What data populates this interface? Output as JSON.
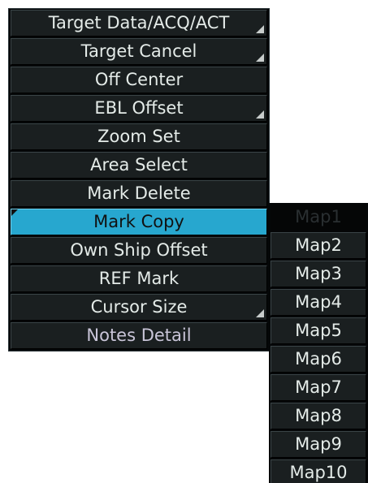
{
  "context_menu": {
    "items": [
      {
        "label": "Target Data/ACQ/ACT",
        "submenu": true
      },
      {
        "label": "Target Cancel",
        "submenu": true
      },
      {
        "label": "Off Center",
        "submenu": false
      },
      {
        "label": "EBL Offset",
        "submenu": true
      },
      {
        "label": "Zoom Set",
        "submenu": false
      },
      {
        "label": "Area Select",
        "submenu": false
      },
      {
        "label": "Mark Delete",
        "submenu": false
      },
      {
        "label": "Mark Copy",
        "submenu": false,
        "selected": true
      },
      {
        "label": "Own Ship Offset",
        "submenu": false
      },
      {
        "label": "REF Mark",
        "submenu": false
      },
      {
        "label": "Cursor Size",
        "submenu": true
      },
      {
        "label": "Notes Detail",
        "submenu": false
      }
    ]
  },
  "map_submenu": {
    "items": [
      {
        "label": "Map1",
        "enabled": false
      },
      {
        "label": "Map2",
        "enabled": true
      },
      {
        "label": "Map3",
        "enabled": true
      },
      {
        "label": "Map4",
        "enabled": true
      },
      {
        "label": "Map5",
        "enabled": true
      },
      {
        "label": "Map6",
        "enabled": true
      },
      {
        "label": "Map7",
        "enabled": true
      },
      {
        "label": "Map8",
        "enabled": true
      },
      {
        "label": "Map9",
        "enabled": true
      },
      {
        "label": "Map10",
        "enabled": true
      }
    ]
  },
  "colors": {
    "selected_item": "#27a7cf",
    "item_background": "#1a1f20",
    "item_text": "#e4ebe8"
  }
}
